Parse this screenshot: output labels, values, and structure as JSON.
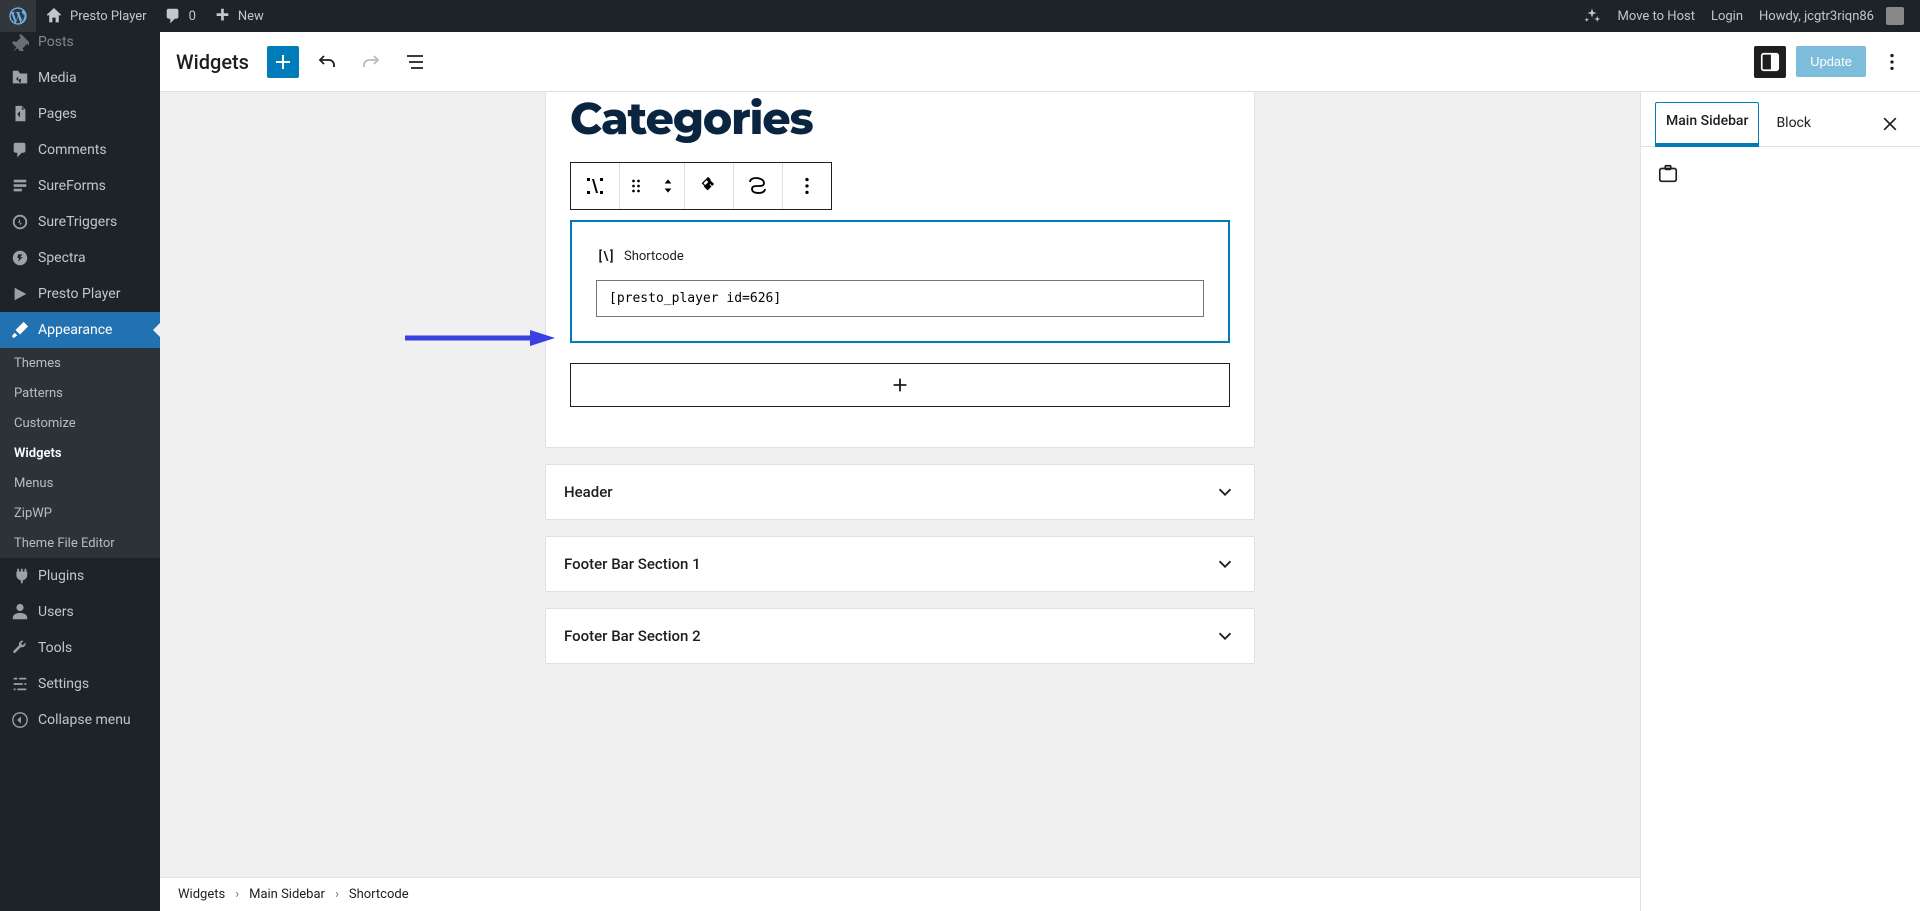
{
  "adminbar": {
    "site_name": "Presto Player",
    "comments_count": "0",
    "new_label": "New",
    "move_to_host": "Move to Host",
    "login": "Login",
    "howdy_prefix": "Howdy, ",
    "user": "jcgtr3riqn86"
  },
  "sidebar": {
    "items": [
      {
        "key": "posts",
        "label": "Posts",
        "icon": "pin"
      },
      {
        "key": "media",
        "label": "Media",
        "icon": "media"
      },
      {
        "key": "pages",
        "label": "Pages",
        "icon": "pages"
      },
      {
        "key": "comments",
        "label": "Comments",
        "icon": "comment"
      },
      {
        "key": "sureforms",
        "label": "SureForms",
        "icon": "form"
      },
      {
        "key": "suretriggers",
        "label": "SureTriggers",
        "icon": "trigger"
      },
      {
        "key": "spectra",
        "label": "Spectra",
        "icon": "spectra"
      },
      {
        "key": "presto",
        "label": "Presto Player",
        "icon": "play"
      },
      {
        "key": "appearance",
        "label": "Appearance",
        "icon": "brush",
        "active": true
      },
      {
        "key": "plugins",
        "label": "Plugins",
        "icon": "plugin"
      },
      {
        "key": "users",
        "label": "Users",
        "icon": "user"
      },
      {
        "key": "tools",
        "label": "Tools",
        "icon": "wrench"
      },
      {
        "key": "settings",
        "label": "Settings",
        "icon": "sliders"
      },
      {
        "key": "collapse",
        "label": "Collapse menu",
        "icon": "collapse"
      }
    ],
    "appearance_sub": [
      {
        "label": "Themes"
      },
      {
        "label": "Patterns"
      },
      {
        "label": "Customize"
      },
      {
        "label": "Widgets",
        "current": true
      },
      {
        "label": "Menus"
      },
      {
        "label": "ZipWP"
      },
      {
        "label": "Theme File Editor"
      }
    ]
  },
  "topbar": {
    "title": "Widgets",
    "update_label": "Update"
  },
  "canvas": {
    "open_area_title": "Categories",
    "shortcode": {
      "label": "Shortcode",
      "value": "[presto_player id=626]"
    },
    "areas": [
      {
        "label": "Header"
      },
      {
        "label": "Footer Bar Section 1"
      },
      {
        "label": "Footer Bar Section 2"
      }
    ],
    "breadcrumbs": [
      "Widgets",
      "Main Sidebar",
      "Shortcode"
    ]
  },
  "settings": {
    "tabs": [
      "Main Sidebar",
      "Block"
    ],
    "active_tab": "Main Sidebar"
  },
  "colors": {
    "accent": "#007cba",
    "annotation": "#3940e3"
  }
}
